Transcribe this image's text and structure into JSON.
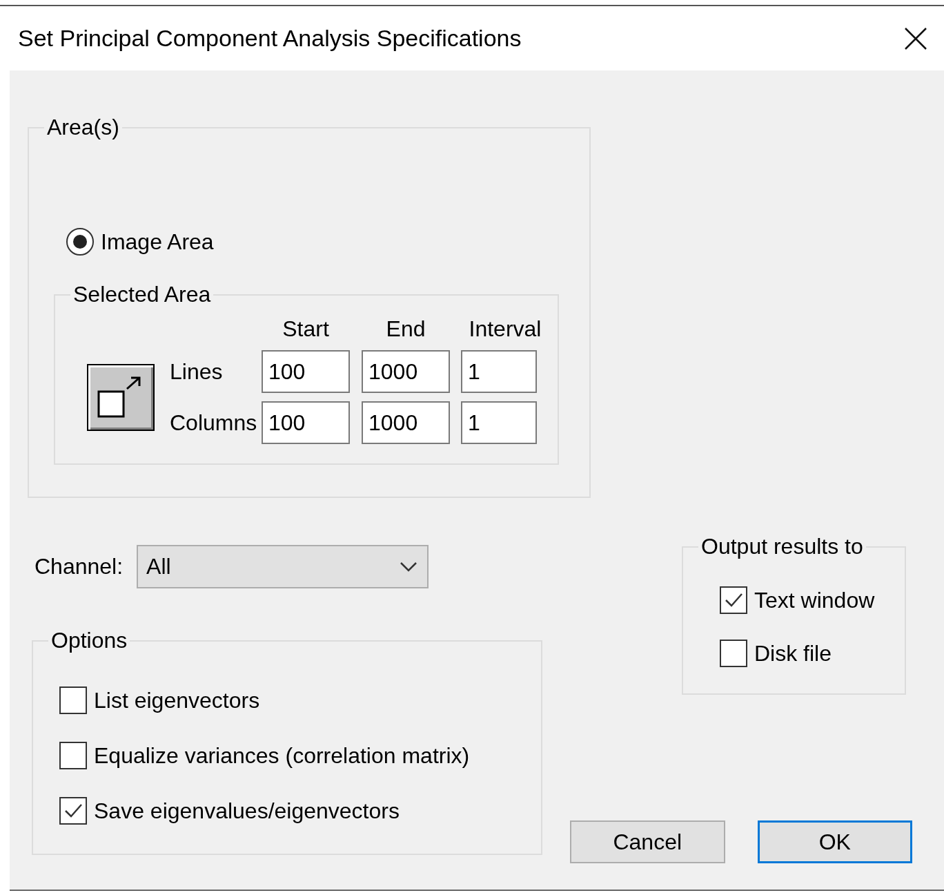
{
  "window": {
    "title": "Set Principal Component Analysis Specifications"
  },
  "areas": {
    "legend": "Area(s)",
    "radio": {
      "label": "Image Area",
      "selected": true
    },
    "selected_area": {
      "legend": "Selected Area",
      "headers": [
        "Start",
        "End",
        "Interval"
      ],
      "rows": [
        {
          "label": "Lines",
          "start": "100",
          "end": "1000",
          "interval": "1"
        },
        {
          "label": "Columns",
          "start": "100",
          "end": "1000",
          "interval": "1"
        }
      ]
    }
  },
  "channel": {
    "label": "Channel:",
    "value": "All"
  },
  "options": {
    "legend": "Options",
    "items": [
      {
        "label": "List eigenvectors",
        "checked": false
      },
      {
        "label": "Equalize variances (correlation matrix)",
        "checked": false
      },
      {
        "label": "Save eigenvalues/eigenvectors",
        "checked": true
      }
    ]
  },
  "output": {
    "legend": "Output results to",
    "items": [
      {
        "label": "Text window",
        "checked": true
      },
      {
        "label": "Disk file",
        "checked": false
      }
    ]
  },
  "buttons": [
    {
      "label": "Cancel",
      "default": false
    },
    {
      "label": "OK",
      "default": true
    }
  ]
}
